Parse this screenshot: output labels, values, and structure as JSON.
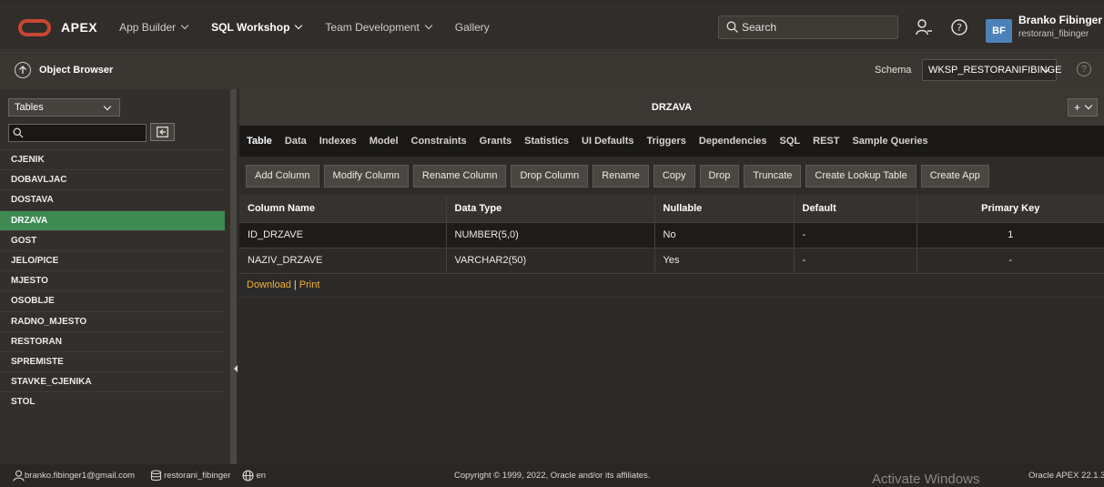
{
  "brand": {
    "name": "APEX"
  },
  "nav": {
    "items": [
      {
        "label": "App Builder",
        "has_menu": true,
        "active": false
      },
      {
        "label": "SQL Workshop",
        "has_menu": true,
        "active": true
      },
      {
        "label": "Team Development",
        "has_menu": true,
        "active": false
      },
      {
        "label": "Gallery",
        "has_menu": false,
        "active": false
      }
    ]
  },
  "search": {
    "placeholder": "Search"
  },
  "user": {
    "initials": "BF",
    "name": "Branko Fibinger",
    "schema": "restorani_fibinger"
  },
  "subbar": {
    "title": "Object Browser",
    "schema_label": "Schema",
    "schema_value": "WKSP_RESTORANIFIBINGE",
    "help": "?"
  },
  "left_panel": {
    "object_type": "Tables",
    "filter_value": "",
    "tables": [
      "CJENIK",
      "DOBAVLJAC",
      "DOSTAVA",
      "DRZAVA",
      "GOST",
      "JELO/PICE",
      "MJESTO",
      "OSOBLJE",
      "RADNO_MJESTO",
      "RESTORAN",
      "SPREMISTE",
      "STAVKE_CJENIKA",
      "STOL"
    ],
    "selected": "DRZAVA"
  },
  "main": {
    "title": "DRZAVA",
    "plus_label": "+",
    "tabs": [
      "Table",
      "Data",
      "Indexes",
      "Model",
      "Constraints",
      "Grants",
      "Statistics",
      "UI Defaults",
      "Triggers",
      "Dependencies",
      "SQL",
      "REST",
      "Sample Queries"
    ],
    "active_tab": "Table",
    "toolbar": [
      "Add Column",
      "Modify Column",
      "Rename Column",
      "Drop Column",
      "Rename",
      "Copy",
      "Drop",
      "Truncate",
      "Create Lookup Table",
      "Create App"
    ],
    "columns_table": {
      "headers": [
        "Column Name",
        "Data Type",
        "Nullable",
        "Default",
        "Primary Key"
      ],
      "rows": [
        [
          "ID_DRZAVE",
          "NUMBER(5,0)",
          "No",
          "-",
          "1"
        ],
        [
          "NAZIV_DRZAVE",
          "VARCHAR2(50)",
          "Yes",
          "-",
          "-"
        ]
      ]
    },
    "links": {
      "download": "Download",
      "separator": "|",
      "print": "Print"
    }
  },
  "footer": {
    "email": "branko.fibinger1@gmail.com",
    "workspace": "restorani_fibinger",
    "language": "en",
    "copyright": "Copyright © 1999, 2022, Oracle and/or its affiliates.",
    "watermark": "Activate Windows",
    "version": "Oracle APEX 22.1.3"
  },
  "colors": {
    "accent_green": "#3e8a52",
    "link_orange": "#f1b13a",
    "logo_red": "#c74634",
    "avatar_blue": "#4d82b8"
  }
}
